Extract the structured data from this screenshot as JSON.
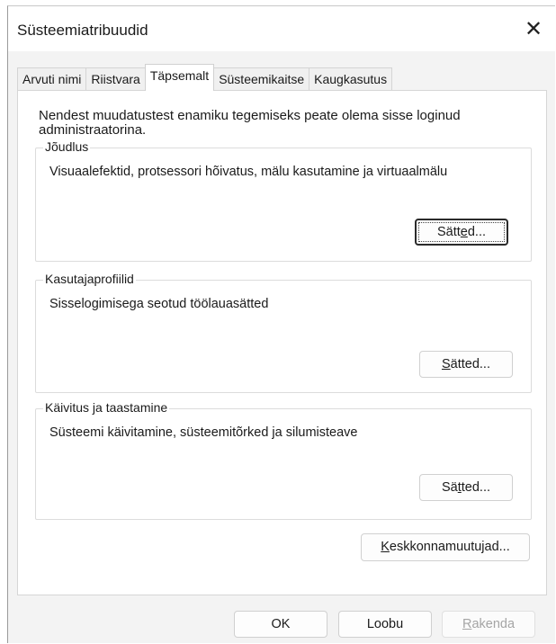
{
  "window": {
    "title": "Süsteemiatribuudid",
    "close_glyph": "✕"
  },
  "tabs": [
    {
      "label": "Arvuti nimi",
      "active": false
    },
    {
      "label": "Riistvara",
      "active": false
    },
    {
      "label": "Täpsemalt",
      "active": true
    },
    {
      "label": "Süsteemikaitse",
      "active": false
    },
    {
      "label": "Kaugkasutus",
      "active": false
    }
  ],
  "intro": "Nendest muudatustest enamiku tegemiseks peate olema sisse loginud administraatorina.",
  "performance": {
    "title": "Jõudlus",
    "description": "Visuaalefektid, protsessori hõivatus, mälu kasutamine ja virtuaalmälu",
    "button": {
      "pre": "Sätt",
      "accel": "e",
      "post": "d..."
    }
  },
  "profiles": {
    "title": "Kasutajaprofiilid",
    "description": "Sisselogimisega seotud töölauasätted",
    "button": {
      "pre": "",
      "accel": "S",
      "post": "ätted..."
    }
  },
  "startup": {
    "title": "Käivitus ja taastamine",
    "description": "Süsteemi käivitamine, süsteemitõrked ja silumisteave",
    "button": {
      "pre": "Sä",
      "accel": "t",
      "post": "ted..."
    }
  },
  "environment_button": {
    "pre": "",
    "accel": "K",
    "post": "eskkonnamuutujad..."
  },
  "footer": {
    "ok": "OK",
    "cancel": "Loobu",
    "apply": {
      "pre": "",
      "accel": "R",
      "post": "akenda"
    }
  }
}
